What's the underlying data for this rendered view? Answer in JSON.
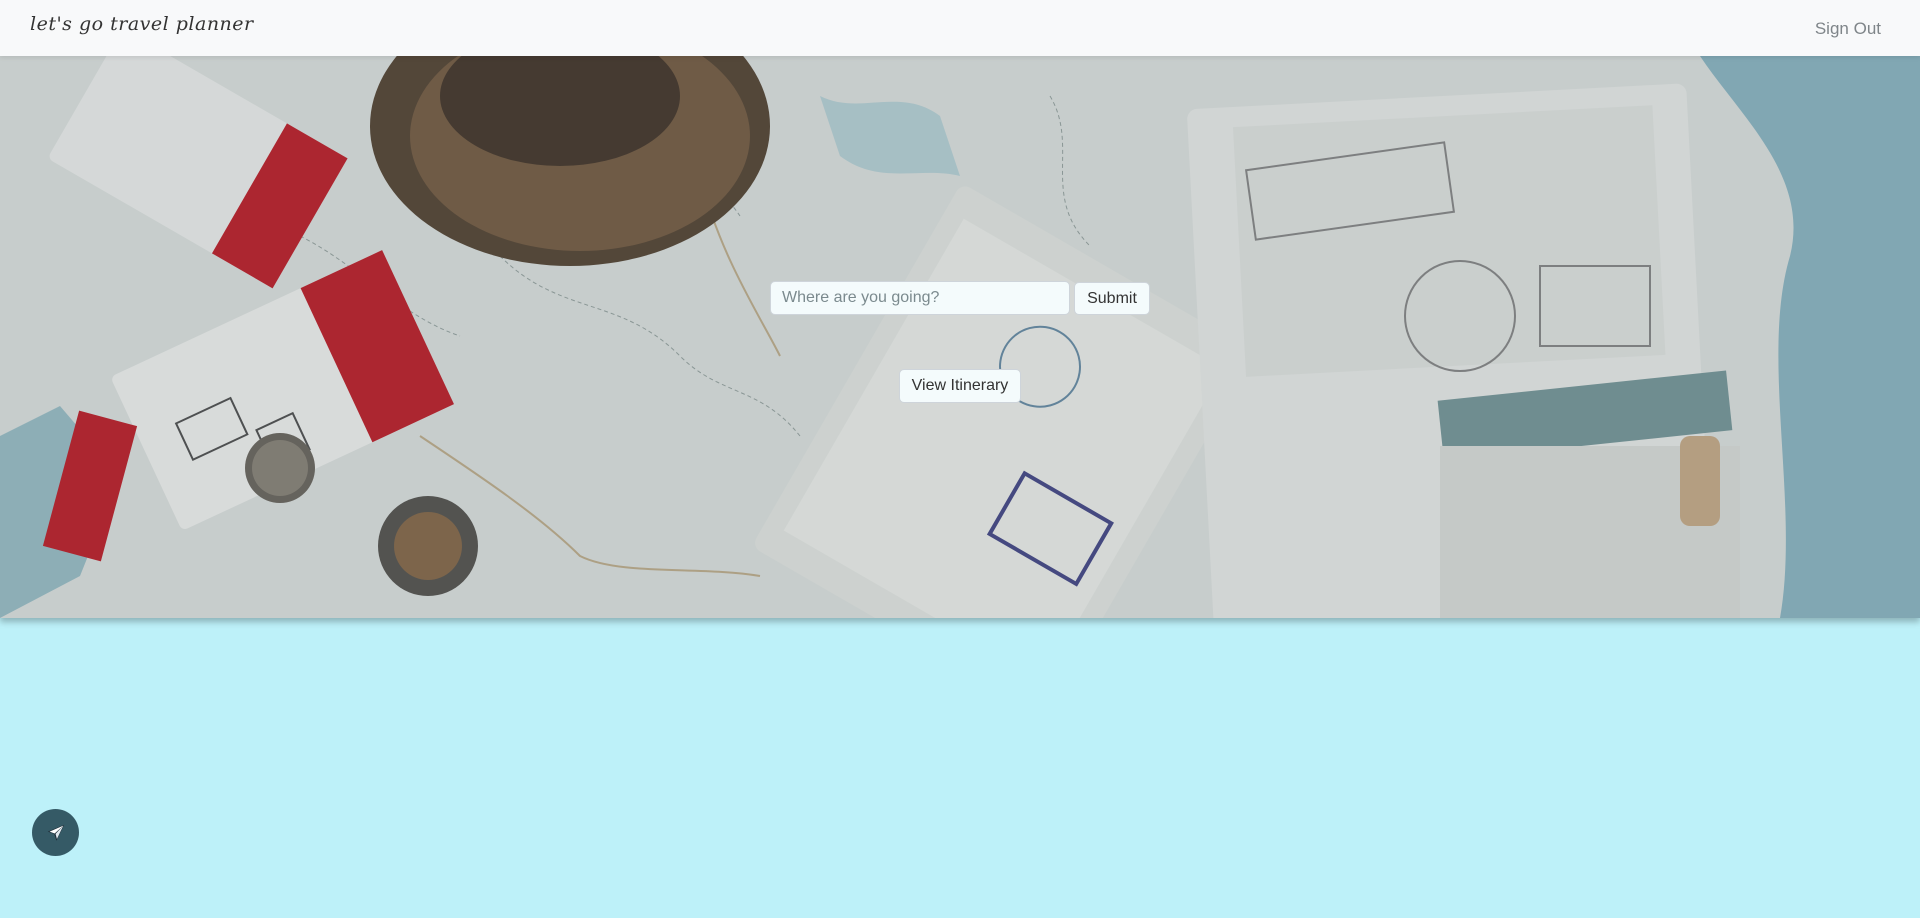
{
  "navbar": {
    "brand": "let's go travel planner",
    "sign_out": "Sign Out"
  },
  "hero": {
    "image_description_icon": "travel-map-passport-photo"
  },
  "search": {
    "placeholder": "Where are you going?",
    "value": "",
    "submit_label": "Submit"
  },
  "itinerary": {
    "label": "View Itinerary"
  },
  "fab": {
    "icon": "airplane-icon"
  },
  "colors": {
    "page_background": "#bdf1f9",
    "navbar_background": "#f8f9fa",
    "fab_background": "#355a66",
    "ticket_red": "#c0252f"
  }
}
